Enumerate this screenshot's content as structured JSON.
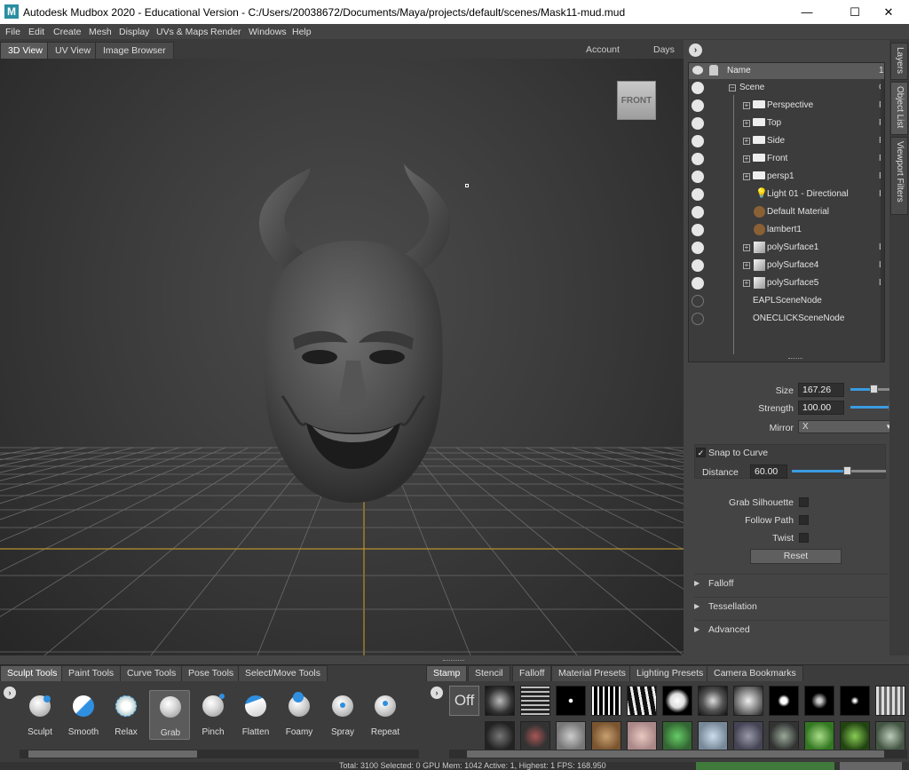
{
  "window": {
    "logo": "M",
    "title": "Autodesk Mudbox 2020 - Educational Version - C:/Users/20038672/Documents/Maya/projects/default/scenes/Mask11-mud.mud",
    "minimize": "—",
    "maximize": "☐",
    "close": "✕"
  },
  "menu": [
    "File",
    "Edit",
    "Create",
    "Mesh",
    "Display",
    "UVs & Maps",
    "Render",
    "Windows",
    "Help"
  ],
  "view_tabs": [
    "3D View",
    "UV View",
    "Image Browser"
  ],
  "view_top_right": {
    "account": "Account",
    "days": "Days"
  },
  "viewcube_label": "FRONT",
  "side_tabs": [
    "Layers",
    "Object List",
    "Viewport Filters"
  ],
  "outliner": {
    "header_name": "Name",
    "header_trunc": "1",
    "rows": [
      {
        "label": "Scene",
        "trunc": "G"
      },
      {
        "label": "Perspective",
        "trunc": "F"
      },
      {
        "label": "Top",
        "trunc": "F"
      },
      {
        "label": "Side",
        "trunc": "F"
      },
      {
        "label": "Front",
        "trunc": "F"
      },
      {
        "label": "persp1",
        "trunc": "F"
      },
      {
        "label": "Light 01 - Directional",
        "trunc": "Ii"
      },
      {
        "label": "Default Material",
        "trunc": ""
      },
      {
        "label": "lambert1",
        "trunc": ""
      },
      {
        "label": "polySurface1",
        "trunc": "L"
      },
      {
        "label": "polySurface4",
        "trunc": "L"
      },
      {
        "label": "polySurface5",
        "trunc": "L"
      },
      {
        "label": "EAPLSceneNode",
        "trunc": ""
      },
      {
        "label": "ONECLICKSceneNode",
        "trunc": ""
      }
    ]
  },
  "properties": {
    "size_label": "Size",
    "size_value": "167.26",
    "size_level": 0.5,
    "strength_label": "Strength",
    "strength_value": "100.00",
    "strength_level": 1.0,
    "mirror_label": "Mirror",
    "mirror_value": "X",
    "snap_label": "Snap to Curve",
    "snap_checked": "✓",
    "distance_label": "Distance",
    "distance_value": "60.00",
    "distance_level": 0.6,
    "grab_silhouette_label": "Grab Silhouette",
    "follow_path_label": "Follow Path",
    "twist_label": "Twist",
    "reset_label": "Reset",
    "sections": [
      "Falloff",
      "Tessellation",
      "Advanced"
    ]
  },
  "tool_tabs": [
    "Sculpt Tools",
    "Paint Tools",
    "Curve Tools",
    "Pose Tools",
    "Select/Move Tools"
  ],
  "tools": [
    "Sculpt",
    "Smooth",
    "Relax",
    "Grab",
    "Pinch",
    "Flatten",
    "Foamy",
    "Spray",
    "Repeat"
  ],
  "stamp_tabs": [
    "Stamp",
    "Stencil",
    "Falloff",
    "Material Presets",
    "Lighting Presets",
    "Camera Bookmarks"
  ],
  "stamp_off_label": "Off",
  "status_text": "Total: 3100  Selected: 0  GPU Mem: 1042  Active: 1, Highest: 1  FPS: 168.950",
  "colors": {
    "accent": "#3a9be0",
    "material": "#8a6035"
  }
}
